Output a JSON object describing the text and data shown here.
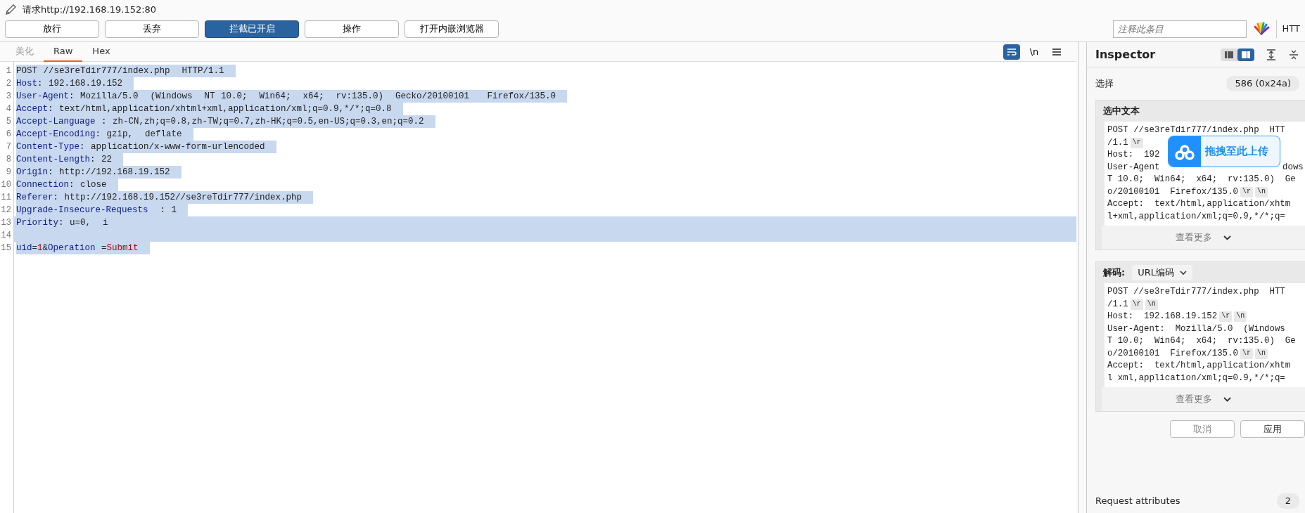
{
  "title": {
    "text": "请求http://192.168.19.152:80"
  },
  "actions": [
    {
      "label": "放行",
      "selected": false
    },
    {
      "label": "丢弃",
      "selected": false
    },
    {
      "label": "拦截已开启",
      "selected": true
    },
    {
      "label": "操作",
      "selected": false
    },
    {
      "label": "打开内嵌浏览器",
      "selected": false
    }
  ],
  "comment_field": {
    "placeholder": "注释此条目"
  },
  "protocol_label": "HTT",
  "editor": {
    "tabs": [
      {
        "label": "美化",
        "selected": false,
        "disabled": true
      },
      {
        "label": "Raw",
        "selected": true,
        "disabled": false
      },
      {
        "label": "Hex",
        "selected": false,
        "disabled": false
      }
    ],
    "wrap_on": true,
    "newline_label": "\\n",
    "lines": [
      {
        "number": "1",
        "selected": true,
        "full_width": false,
        "segments": [
          {
            "kind": "plain",
            "text": "POST //se3reTdir777/index.php  HTTP/1.1"
          }
        ]
      },
      {
        "number": "2",
        "selected": true,
        "full_width": false,
        "segments": [
          {
            "kind": "name",
            "text": "Host"
          },
          {
            "kind": "plain",
            "text": ": 192.168.19.152"
          }
        ]
      },
      {
        "number": "3",
        "selected": true,
        "full_width": false,
        "segments": [
          {
            "kind": "name",
            "text": "User-Agent"
          },
          {
            "kind": "plain",
            "text": ": Mozilla/5.0  (Windows  NT 10.0;  Win64;  x64;  rv:135.0)  Gecko/20100101   Firefox/135.0"
          }
        ]
      },
      {
        "number": "4",
        "selected": true,
        "full_width": false,
        "segments": [
          {
            "kind": "name",
            "text": "Accept"
          },
          {
            "kind": "plain",
            "text": ": text/html,application/xhtml+xml,application/xml;q=0.9,*/*;q=0.8"
          }
        ]
      },
      {
        "number": "5",
        "selected": true,
        "full_width": false,
        "segments": [
          {
            "kind": "name",
            "text": "Accept-Language"
          },
          {
            "kind": "plain",
            "text": " : zh-CN,zh;q=0.8,zh-TW;q=0.7,zh-HK;q=0.5,en-US;q=0.3,en;q=0.2"
          }
        ]
      },
      {
        "number": "6",
        "selected": true,
        "full_width": false,
        "segments": [
          {
            "kind": "name",
            "text": "Accept-Encoding"
          },
          {
            "kind": "plain",
            "text": ": gzip,  deflate"
          }
        ]
      },
      {
        "number": "7",
        "selected": true,
        "full_width": false,
        "segments": [
          {
            "kind": "name",
            "text": "Content-Type"
          },
          {
            "kind": "plain",
            "text": ": application/x-www-form-urlencoded"
          }
        ]
      },
      {
        "number": "8",
        "selected": true,
        "full_width": false,
        "segments": [
          {
            "kind": "name",
            "text": "Content-Length"
          },
          {
            "kind": "plain",
            "text": ": 22"
          }
        ]
      },
      {
        "number": "9",
        "selected": true,
        "full_width": false,
        "segments": [
          {
            "kind": "name",
            "text": "Origin"
          },
          {
            "kind": "plain",
            "text": ": http://192.168.19.152"
          }
        ]
      },
      {
        "number": "10",
        "selected": true,
        "full_width": false,
        "segments": [
          {
            "kind": "name",
            "text": "Connection"
          },
          {
            "kind": "plain",
            "text": ": close"
          }
        ]
      },
      {
        "number": "11",
        "selected": true,
        "full_width": false,
        "segments": [
          {
            "kind": "name",
            "text": "Referer"
          },
          {
            "kind": "plain",
            "text": ": http://192.168.19.152//se3reTdir777/index.php"
          }
        ]
      },
      {
        "number": "12",
        "selected": true,
        "full_width": false,
        "segments": [
          {
            "kind": "name",
            "text": "Upgrade-Insecure-Requests"
          },
          {
            "kind": "plain",
            "text": "  : 1"
          }
        ]
      },
      {
        "number": "13",
        "selected": true,
        "full_width": true,
        "segments": [
          {
            "kind": "name",
            "text": "Priority"
          },
          {
            "kind": "plain",
            "text": ": u=0,  i"
          }
        ]
      },
      {
        "number": "14",
        "selected": true,
        "full_width": true
      },
      {
        "number": "15",
        "selected": true,
        "full_width": false,
        "segments": [
          {
            "kind": "name",
            "text": "uid"
          },
          {
            "kind": "plain",
            "text": "="
          },
          {
            "kind": "value",
            "text": "1"
          },
          {
            "kind": "plain",
            "text": "&"
          },
          {
            "kind": "name",
            "text": "Operation"
          },
          {
            "kind": "plain",
            "text": " ="
          },
          {
            "kind": "value",
            "text": "Submit"
          }
        ]
      }
    ]
  },
  "inspector": {
    "title": "Inspector",
    "layout_toggle": [
      {
        "selected": false
      },
      {
        "selected": true
      }
    ],
    "selection": {
      "label": "选择",
      "value": "586 (0x24a)"
    },
    "sections": [
      {
        "kind": "plain",
        "title": "选中文本",
        "more": "查看更多",
        "lines": [
          [
            {
              "kind": "text",
              "text": "POST //se3reTdir777/index.php  HTT"
            }
          ],
          [
            {
              "kind": "text",
              "text": "/1.1"
            },
            {
              "kind": "chip",
              "text": "\\r"
            }
          ],
          [
            {
              "kind": "text",
              "text": "Host:  192"
            }
          ],
          [
            {
              "kind": "text",
              "text": "User-Agent"
            },
            {
              "kind": "tail",
              "text": "dows"
            }
          ],
          [
            {
              "kind": "text",
              "text": "T 10.0;  Win64;  x64;  rv:135.0)  Ge"
            }
          ],
          [
            {
              "kind": "text",
              "text": "o/20100101  Firefox/135.0"
            },
            {
              "kind": "chip",
              "text": "\\r"
            },
            {
              "kind": "chip",
              "text": "\\n"
            }
          ],
          [
            {
              "kind": "text",
              "text": "Accept:  text/html,application/xhtm"
            }
          ],
          [
            {
              "kind": "text",
              "text": "l+xml,application/xml;q=0.9,*/*;q="
            }
          ]
        ]
      },
      {
        "kind": "decode",
        "title": "解码:",
        "decoder": "URL编码",
        "more": "查看更多",
        "lines": [
          [
            {
              "kind": "text",
              "text": "POST //se3reTdir777/index.php  HTT"
            }
          ],
          [
            {
              "kind": "text",
              "text": "/1.1"
            },
            {
              "kind": "chip",
              "text": "\\r"
            },
            {
              "kind": "chip",
              "text": "\\n"
            }
          ],
          [
            {
              "kind": "text",
              "text": "Host:  192.168.19.152"
            },
            {
              "kind": "chip",
              "text": "\\r"
            },
            {
              "kind": "chip",
              "text": "\\n"
            }
          ],
          [
            {
              "kind": "text",
              "text": "User-Agent:  Mozilla/5.0  (Windows"
            }
          ],
          [
            {
              "kind": "text",
              "text": "T 10.0;  Win64;  x64;  rv:135.0)  Ge"
            }
          ],
          [
            {
              "kind": "text",
              "text": "o/20100101  Firefox/135.0"
            },
            {
              "kind": "chip",
              "text": "\\r"
            },
            {
              "kind": "chip",
              "text": "\\n"
            }
          ],
          [
            {
              "kind": "text",
              "text": "Accept:  text/html,application/xhtm"
            }
          ],
          [
            {
              "kind": "text",
              "text": "l xml,application/xml;q=0.9,*/*;q="
            }
          ]
        ]
      }
    ],
    "buttons": [
      "取消",
      "应用"
    ],
    "attributes": {
      "label": "Request attributes",
      "count": "2"
    }
  },
  "upload_overlay": {
    "text": "拖拽至此上传"
  }
}
